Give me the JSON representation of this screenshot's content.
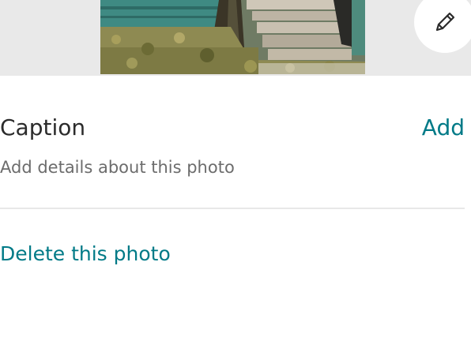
{
  "photo": {
    "edit_icon": "pencil-icon"
  },
  "caption": {
    "title": "Caption",
    "add_label": "Add",
    "hint": "Add details about this photo"
  },
  "actions": {
    "delete_label": "Delete this photo"
  },
  "colors": {
    "accent": "#007a87",
    "text_primary": "#2b2b2b",
    "text_secondary": "#6c6c6c",
    "photo_background": "#e9e9e9",
    "divider": "#e8e8e8"
  }
}
